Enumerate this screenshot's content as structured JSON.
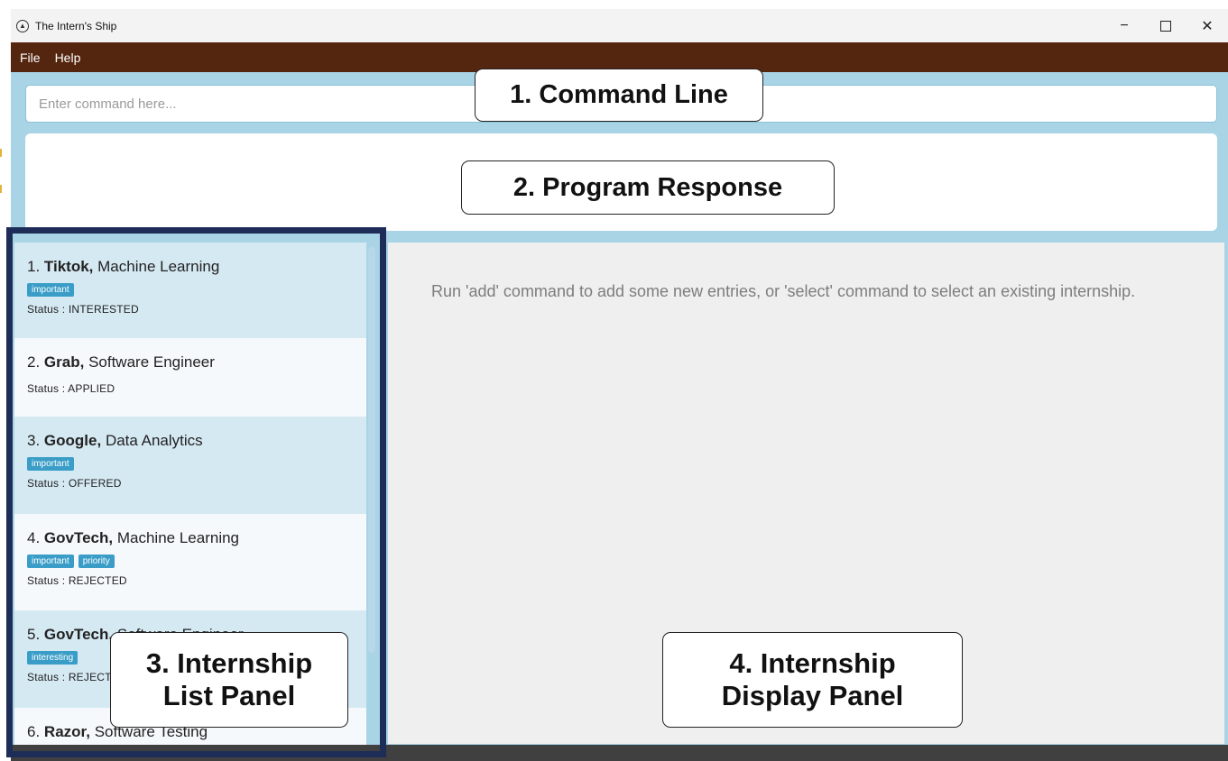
{
  "window": {
    "title": "The Intern's Ship",
    "controls": {
      "minimize": "−",
      "maximize": "□",
      "close": "✕"
    }
  },
  "menu": [
    "File",
    "Help"
  ],
  "command": {
    "placeholder": "Enter command here...",
    "value": ""
  },
  "internships": [
    {
      "index": "1.",
      "company": "Tiktok,",
      "role": "Machine Learning",
      "tags": [
        "important"
      ],
      "status": "Status : INTERESTED"
    },
    {
      "index": "2.",
      "company": "Grab,",
      "role": "Software Engineer",
      "tags": [],
      "status": "Status : APPLIED"
    },
    {
      "index": "3.",
      "company": "Google,",
      "role": "Data Analytics",
      "tags": [
        "important"
      ],
      "status": "Status : OFFERED"
    },
    {
      "index": "4.",
      "company": "GovTech,",
      "role": "Machine Learning",
      "tags": [
        "important",
        "priority"
      ],
      "status": "Status : REJECTED"
    },
    {
      "index": "5.",
      "company": "GovTech,",
      "role": "Software Engineer",
      "tags": [
        "interesting"
      ],
      "status": "Status : REJECTED"
    },
    {
      "index": "6.",
      "company": "Razor,",
      "role": "Software Testing",
      "tags": [],
      "status": ""
    }
  ],
  "display": {
    "message": "Run 'add' command to add some new entries, or 'select' command to select an existing internship."
  },
  "callouts": {
    "command_line": "1. Command Line",
    "program_response": "2. Program Response",
    "list_panel": [
      "3. Internship",
      "List Panel"
    ],
    "display_panel": [
      "4. Internship",
      "Display Panel"
    ]
  },
  "colors": {
    "menubar": "#55260f",
    "window_bg": "#a9d4e6",
    "tag": "#3a9dc7",
    "highlight_frame": "#1d2d57",
    "alt_row": "#d5e9f3"
  },
  "icons": {
    "app": "ship-icon"
  }
}
